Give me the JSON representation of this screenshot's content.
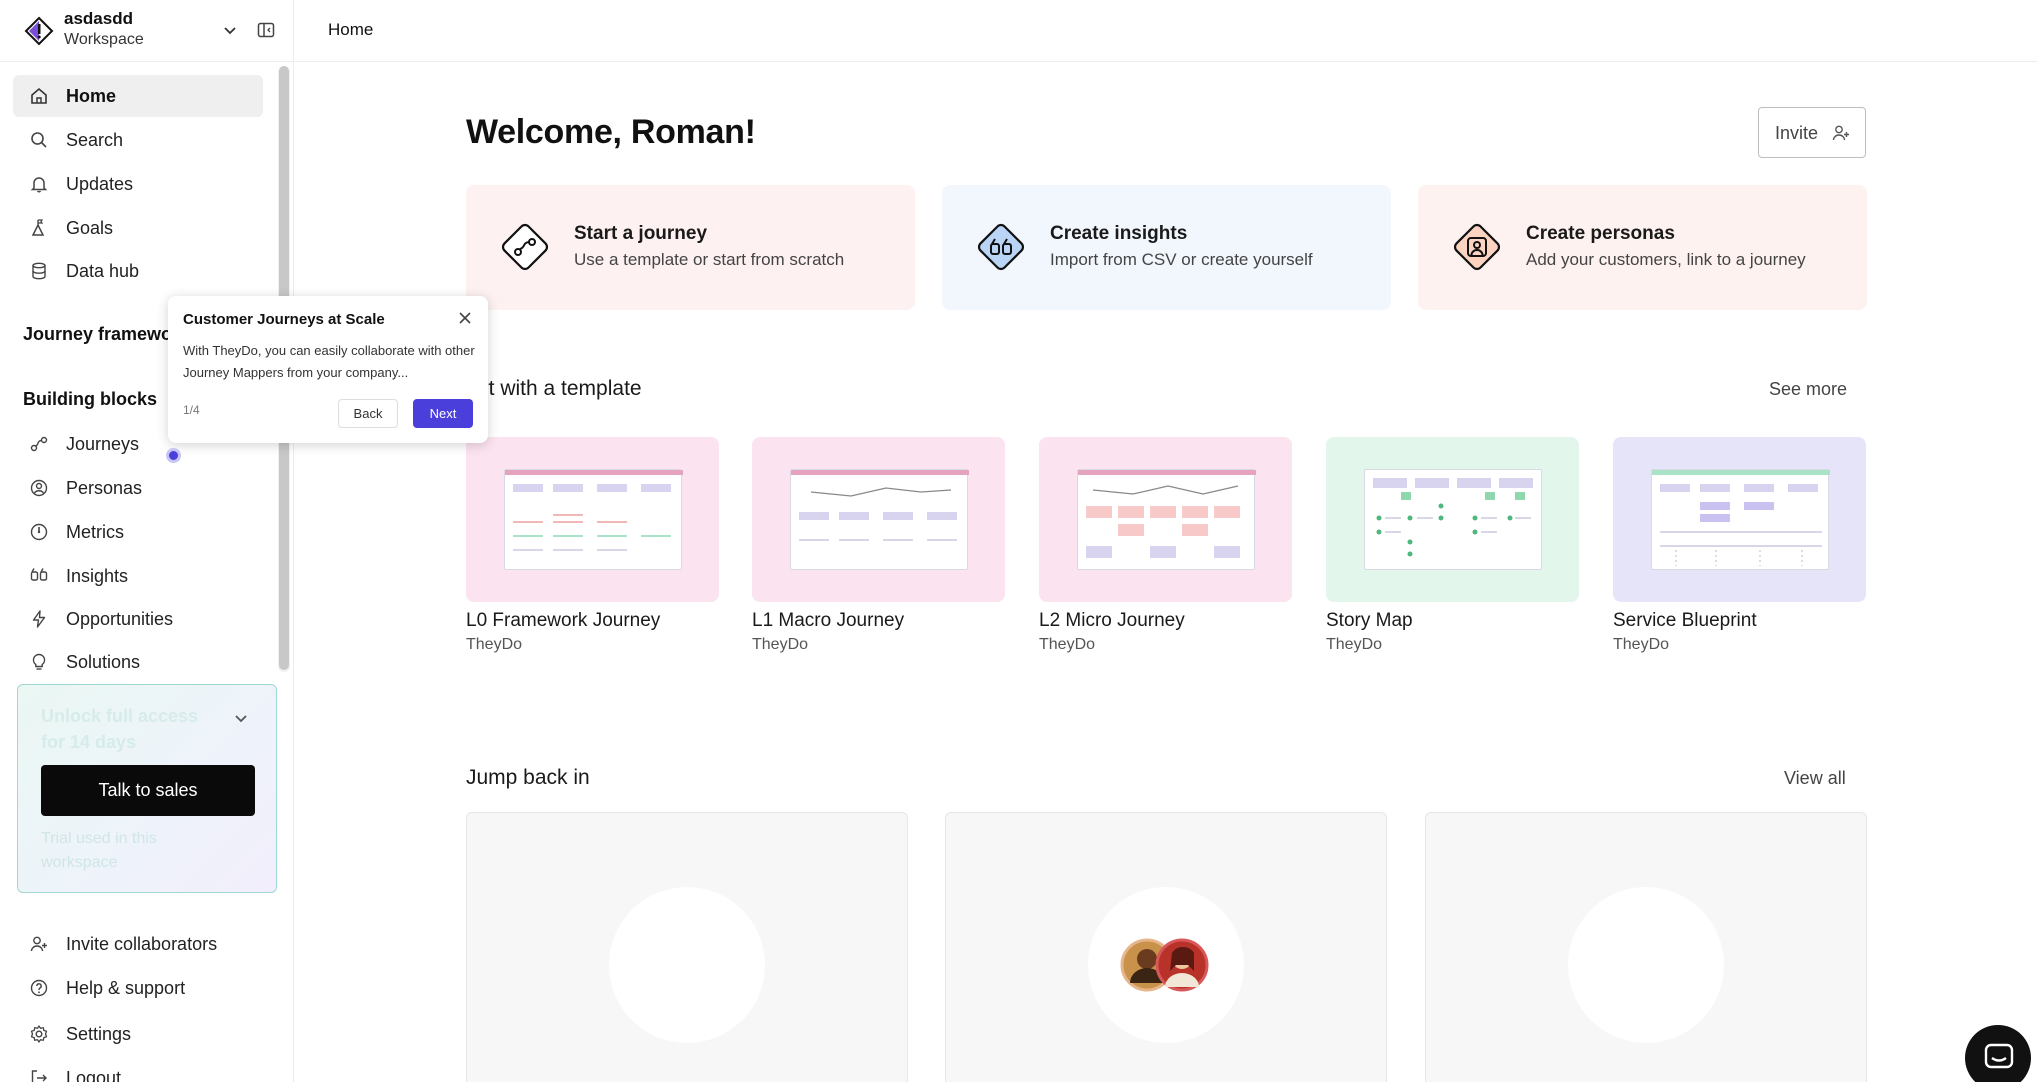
{
  "workspace": {
    "name": "asdasdd",
    "subtitle": "Workspace"
  },
  "breadcrumb": "Home",
  "nav": {
    "main": [
      {
        "label": "Home",
        "icon": "home-icon",
        "active": true
      },
      {
        "label": "Search",
        "icon": "search-icon"
      },
      {
        "label": "Updates",
        "icon": "bell-icon"
      },
      {
        "label": "Goals",
        "icon": "goals-icon"
      },
      {
        "label": "Data hub",
        "icon": "database-icon"
      }
    ],
    "journey_frameworks_label": "Journey framewo",
    "building_blocks_label": "Building blocks",
    "blocks": [
      {
        "label": "Journeys",
        "icon": "journeys-icon"
      },
      {
        "label": "Personas",
        "icon": "persona-icon"
      },
      {
        "label": "Metrics",
        "icon": "metrics-icon"
      },
      {
        "label": "Insights",
        "icon": "quote-icon"
      },
      {
        "label": "Opportunities",
        "icon": "lightning-icon"
      },
      {
        "label": "Solutions",
        "icon": "lightbulb-icon"
      }
    ],
    "bottom": [
      {
        "label": "Invite collaborators",
        "icon": "add-user-icon"
      },
      {
        "label": "Help & support",
        "icon": "help-icon"
      },
      {
        "label": "Settings",
        "icon": "gear-icon"
      },
      {
        "label": "Logout",
        "icon": "logout-icon"
      }
    ]
  },
  "trial": {
    "title": "Unlock full access for 14 days",
    "button": "Talk to sales",
    "note": "Trial used in this workspace"
  },
  "main": {
    "welcome": "Welcome, Roman!",
    "invite_label": "Invite",
    "actions": [
      {
        "title": "Start a journey",
        "subtitle": "Use a template or start from scratch",
        "icon": "journey-diamond-icon",
        "bg": "#fdf1f1"
      },
      {
        "title": "Create insights",
        "subtitle": "Import from CSV or create yourself",
        "icon": "insights-diamond-icon",
        "bg": "#f2f6fd"
      },
      {
        "title": "Create personas",
        "subtitle": "Add your customers, link to a journey",
        "icon": "persona-diamond-icon",
        "bg": "#fdf2ef"
      }
    ],
    "templates_title": "Start with a template",
    "templates_title_visible": "art with a template",
    "see_more": "See more",
    "templates": [
      {
        "name": "L0 Framework Journey",
        "author": "TheyDo",
        "bg": "#fbe3ef"
      },
      {
        "name": "L1 Macro Journey",
        "author": "TheyDo",
        "bg": "#fbe3ef"
      },
      {
        "name": "L2 Micro Journey",
        "author": "TheyDo",
        "bg": "#fbe3ef"
      },
      {
        "name": "Story Map",
        "author": "TheyDo",
        "bg": "#e3f6ec"
      },
      {
        "name": "Service Blueprint",
        "author": "TheyDo",
        "bg": "#e6e4f8"
      }
    ],
    "jump_back_title": "Jump back in",
    "view_all": "View all"
  },
  "tour": {
    "title": "Customer Journeys at Scale",
    "body": "With TheyDo, you can easily collaborate with other Journey Mappers from your company...",
    "step": "1/4",
    "back": "Back",
    "next": "Next"
  },
  "colors": {
    "accent": "#4a3fdb",
    "sidebar_active": "#efefef"
  }
}
